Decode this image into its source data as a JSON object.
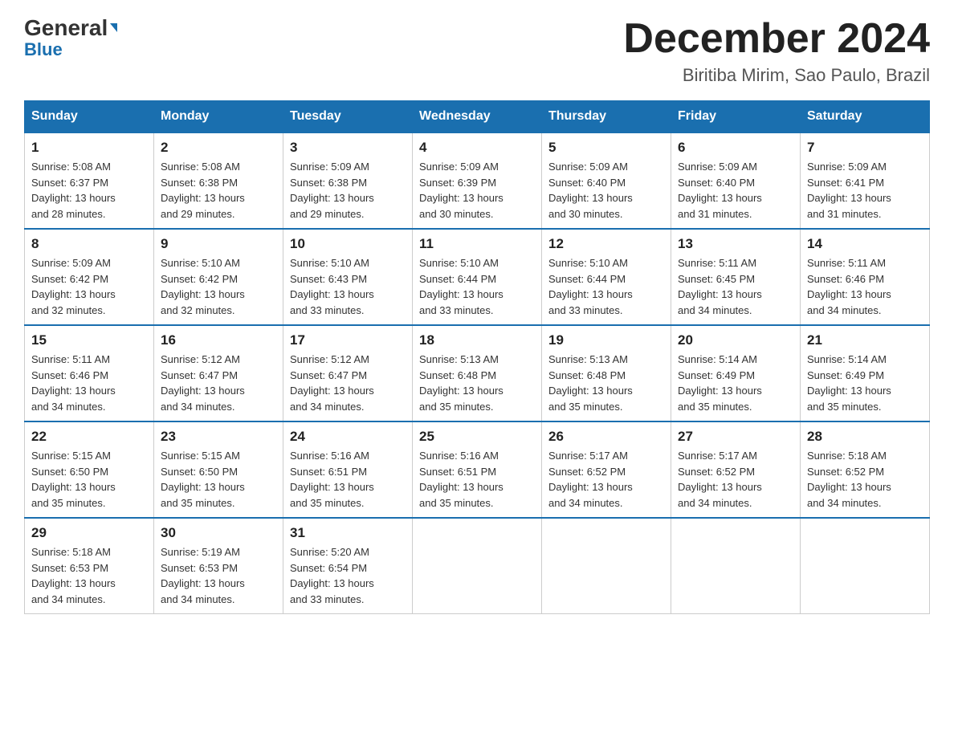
{
  "logo": {
    "general": "General",
    "blue": "Blue",
    "triangle_char": "▶"
  },
  "title": {
    "month_year": "December 2024",
    "location": "Biritiba Mirim, Sao Paulo, Brazil"
  },
  "weekdays": [
    "Sunday",
    "Monday",
    "Tuesday",
    "Wednesday",
    "Thursday",
    "Friday",
    "Saturday"
  ],
  "weeks": [
    [
      {
        "day": "1",
        "sunrise": "5:08 AM",
        "sunset": "6:37 PM",
        "daylight": "13 hours and 28 minutes."
      },
      {
        "day": "2",
        "sunrise": "5:08 AM",
        "sunset": "6:38 PM",
        "daylight": "13 hours and 29 minutes."
      },
      {
        "day": "3",
        "sunrise": "5:09 AM",
        "sunset": "6:38 PM",
        "daylight": "13 hours and 29 minutes."
      },
      {
        "day": "4",
        "sunrise": "5:09 AM",
        "sunset": "6:39 PM",
        "daylight": "13 hours and 30 minutes."
      },
      {
        "day": "5",
        "sunrise": "5:09 AM",
        "sunset": "6:40 PM",
        "daylight": "13 hours and 30 minutes."
      },
      {
        "day": "6",
        "sunrise": "5:09 AM",
        "sunset": "6:40 PM",
        "daylight": "13 hours and 31 minutes."
      },
      {
        "day": "7",
        "sunrise": "5:09 AM",
        "sunset": "6:41 PM",
        "daylight": "13 hours and 31 minutes."
      }
    ],
    [
      {
        "day": "8",
        "sunrise": "5:09 AM",
        "sunset": "6:42 PM",
        "daylight": "13 hours and 32 minutes."
      },
      {
        "day": "9",
        "sunrise": "5:10 AM",
        "sunset": "6:42 PM",
        "daylight": "13 hours and 32 minutes."
      },
      {
        "day": "10",
        "sunrise": "5:10 AM",
        "sunset": "6:43 PM",
        "daylight": "13 hours and 33 minutes."
      },
      {
        "day": "11",
        "sunrise": "5:10 AM",
        "sunset": "6:44 PM",
        "daylight": "13 hours and 33 minutes."
      },
      {
        "day": "12",
        "sunrise": "5:10 AM",
        "sunset": "6:44 PM",
        "daylight": "13 hours and 33 minutes."
      },
      {
        "day": "13",
        "sunrise": "5:11 AM",
        "sunset": "6:45 PM",
        "daylight": "13 hours and 34 minutes."
      },
      {
        "day": "14",
        "sunrise": "5:11 AM",
        "sunset": "6:46 PM",
        "daylight": "13 hours and 34 minutes."
      }
    ],
    [
      {
        "day": "15",
        "sunrise": "5:11 AM",
        "sunset": "6:46 PM",
        "daylight": "13 hours and 34 minutes."
      },
      {
        "day": "16",
        "sunrise": "5:12 AM",
        "sunset": "6:47 PM",
        "daylight": "13 hours and 34 minutes."
      },
      {
        "day": "17",
        "sunrise": "5:12 AM",
        "sunset": "6:47 PM",
        "daylight": "13 hours and 34 minutes."
      },
      {
        "day": "18",
        "sunrise": "5:13 AM",
        "sunset": "6:48 PM",
        "daylight": "13 hours and 35 minutes."
      },
      {
        "day": "19",
        "sunrise": "5:13 AM",
        "sunset": "6:48 PM",
        "daylight": "13 hours and 35 minutes."
      },
      {
        "day": "20",
        "sunrise": "5:14 AM",
        "sunset": "6:49 PM",
        "daylight": "13 hours and 35 minutes."
      },
      {
        "day": "21",
        "sunrise": "5:14 AM",
        "sunset": "6:49 PM",
        "daylight": "13 hours and 35 minutes."
      }
    ],
    [
      {
        "day": "22",
        "sunrise": "5:15 AM",
        "sunset": "6:50 PM",
        "daylight": "13 hours and 35 minutes."
      },
      {
        "day": "23",
        "sunrise": "5:15 AM",
        "sunset": "6:50 PM",
        "daylight": "13 hours and 35 minutes."
      },
      {
        "day": "24",
        "sunrise": "5:16 AM",
        "sunset": "6:51 PM",
        "daylight": "13 hours and 35 minutes."
      },
      {
        "day": "25",
        "sunrise": "5:16 AM",
        "sunset": "6:51 PM",
        "daylight": "13 hours and 35 minutes."
      },
      {
        "day": "26",
        "sunrise": "5:17 AM",
        "sunset": "6:52 PM",
        "daylight": "13 hours and 34 minutes."
      },
      {
        "day": "27",
        "sunrise": "5:17 AM",
        "sunset": "6:52 PM",
        "daylight": "13 hours and 34 minutes."
      },
      {
        "day": "28",
        "sunrise": "5:18 AM",
        "sunset": "6:52 PM",
        "daylight": "13 hours and 34 minutes."
      }
    ],
    [
      {
        "day": "29",
        "sunrise": "5:18 AM",
        "sunset": "6:53 PM",
        "daylight": "13 hours and 34 minutes."
      },
      {
        "day": "30",
        "sunrise": "5:19 AM",
        "sunset": "6:53 PM",
        "daylight": "13 hours and 34 minutes."
      },
      {
        "day": "31",
        "sunrise": "5:20 AM",
        "sunset": "6:54 PM",
        "daylight": "13 hours and 33 minutes."
      },
      null,
      null,
      null,
      null
    ]
  ],
  "labels": {
    "sunrise": "Sunrise:",
    "sunset": "Sunset:",
    "daylight": "Daylight:"
  }
}
